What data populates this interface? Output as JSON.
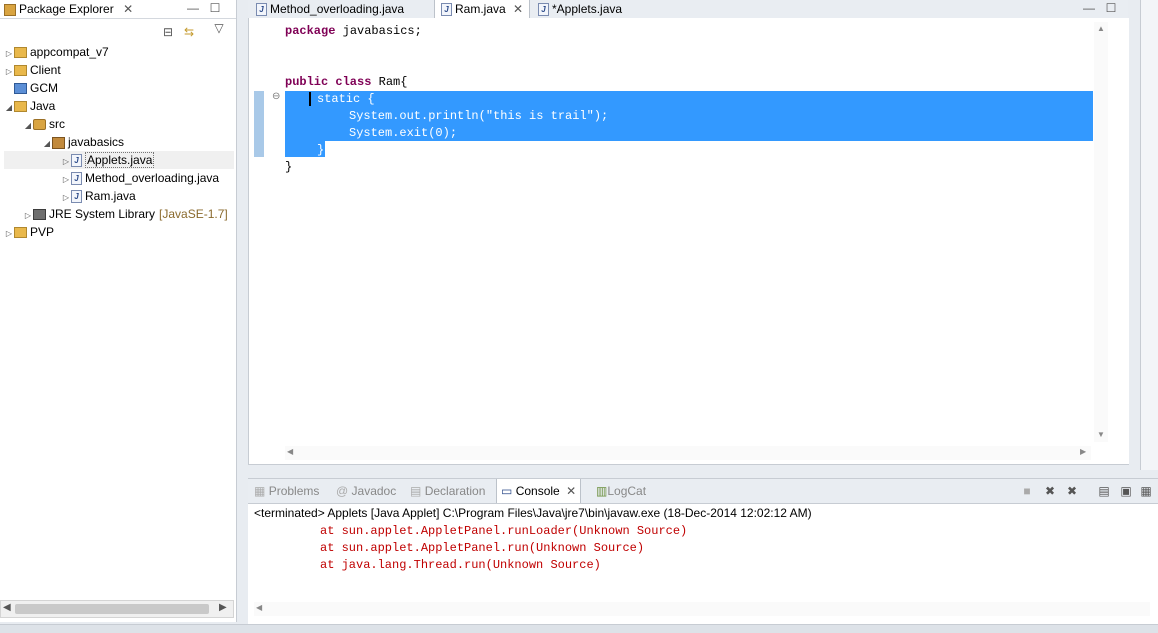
{
  "package_explorer": {
    "title": "Package Explorer",
    "tree": [
      {
        "label": "appcompat_v7",
        "indent": 0,
        "icon": "project-icon",
        "toggle": "▷"
      },
      {
        "label": "Client",
        "indent": 0,
        "icon": "project-icon",
        "toggle": "▷"
      },
      {
        "label": "GCM",
        "indent": 0,
        "icon": "gcm-icon",
        "toggle": ""
      },
      {
        "label": "Java",
        "indent": 0,
        "icon": "project-icon",
        "toggle": "◢"
      },
      {
        "label": "src",
        "indent": 1,
        "icon": "src-folder-icon",
        "toggle": "◢"
      },
      {
        "label": "javabasics",
        "indent": 2,
        "icon": "package-icon",
        "toggle": "◢"
      },
      {
        "label": "Applets.java",
        "indent": 3,
        "icon": "java-file-icon",
        "toggle": "▷"
      },
      {
        "label": "Method_overloading.java",
        "indent": 3,
        "icon": "java-file-icon",
        "toggle": "▷"
      },
      {
        "label": "Ram.java",
        "indent": 3,
        "icon": "java-file-icon",
        "toggle": "▷"
      },
      {
        "label": "JRE System Library",
        "tag": "[JavaSE-1.7]",
        "indent": 1,
        "icon": "jre-library-icon",
        "toggle": "▷"
      },
      {
        "label": "PVP",
        "indent": 0,
        "icon": "project-icon",
        "toggle": "▷"
      }
    ]
  },
  "editor": {
    "tabs": [
      {
        "label": "Method_overloading.java",
        "active": false
      },
      {
        "label": "Ram.java",
        "active": true
      },
      {
        "label": "*Applets.java",
        "active": false
      }
    ],
    "code": {
      "line1_kw": "package",
      "line1_rest": " javabasics;",
      "line2_kw": "public class",
      "line2_rest": " Ram{",
      "line3": "static {",
      "line4": "System.out.println(\"this is trail\");",
      "line5": "System.exit(0);",
      "line6": "}",
      "line7": "}"
    }
  },
  "bottom_panel": {
    "tabs": [
      {
        "label": "Problems",
        "active": false
      },
      {
        "label": "Javadoc",
        "active": false
      },
      {
        "label": "Declaration",
        "active": false
      },
      {
        "label": "Console",
        "active": true
      },
      {
        "label": "LogCat",
        "active": false
      }
    ],
    "console_header": "<terminated> Applets [Java Applet] C:\\Program Files\\Java\\jre7\\bin\\javaw.exe (18-Dec-2014 12:02:12 AM)",
    "console_lines": [
      "at sun.applet.AppletPanel.runLoader(Unknown Source)",
      "at sun.applet.AppletPanel.run(Unknown Source)",
      "at java.lang.Thread.run(Unknown Source)"
    ]
  },
  "colors": {
    "selection": "#3399ff",
    "keyword": "#7f0055",
    "console_error": "#c00000"
  }
}
